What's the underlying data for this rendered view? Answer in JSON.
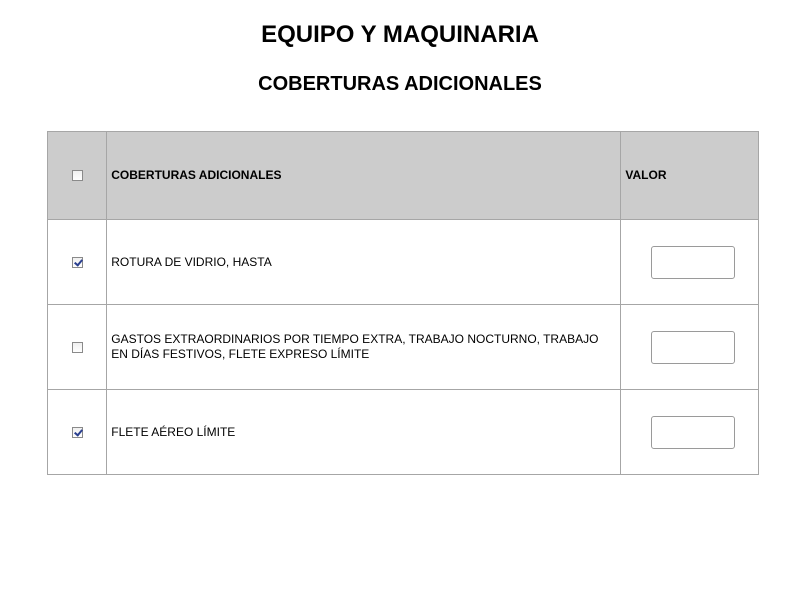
{
  "header": {
    "title": "EQUIPO Y MAQUINARIA",
    "subtitle": "COBERTURAS ADICIONALES"
  },
  "table": {
    "columns": {
      "description": "COBERTURAS ADICIONALES",
      "value": "VALOR"
    },
    "header_checked": false,
    "rows": [
      {
        "checked": true,
        "label": "ROTURA DE VIDRIO, HASTA",
        "value": ""
      },
      {
        "checked": false,
        "label": "GASTOS EXTRAORDINARIOS POR TIEMPO EXTRA, TRABAJO NOCTURNO, TRABAJO EN DÍAS FESTIVOS, FLETE EXPRESO LÍMITE",
        "value": ""
      },
      {
        "checked": true,
        "label": "FLETE AÉREO LÍMITE",
        "value": ""
      }
    ]
  },
  "colors": {
    "header_bg": "#cccccc",
    "border": "#a6a6a6",
    "check_mark": "#2a3f8f"
  }
}
